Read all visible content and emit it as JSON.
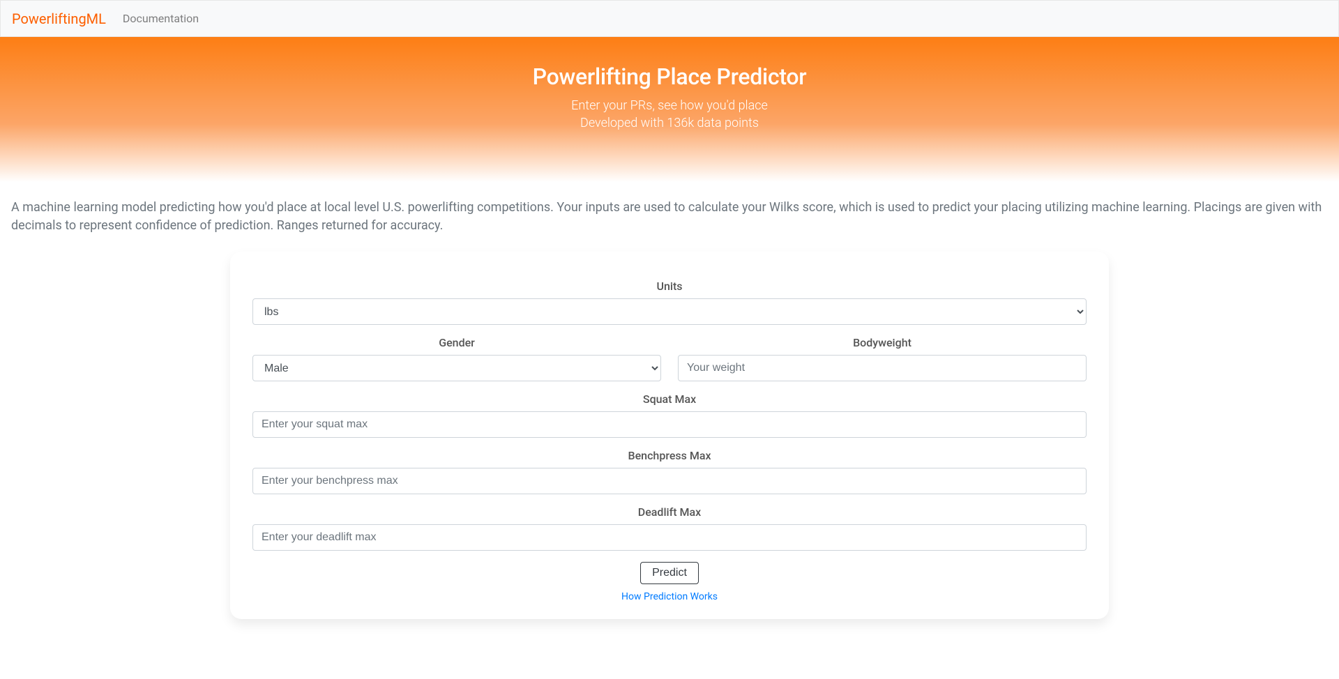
{
  "nav": {
    "brand": "PowerliftingML",
    "doc_link": "Documentation"
  },
  "hero": {
    "title": "Powerlifting Place Predictor",
    "sub1": "Enter your PRs, see how you'd place",
    "sub2": "Developed with 136k data points"
  },
  "description": "A machine learning model predicting how you'd place at local level U.S. powerlifting competitions. Your inputs are used to calculate your Wilks score, which is used to predict your placing utilizing machine learning. Placings are given with decimals to represent confidence of prediction. Ranges returned for accuracy.",
  "form": {
    "units_label": "Units",
    "units_selected": "lbs",
    "gender_label": "Gender",
    "gender_selected": "Male",
    "bodyweight_label": "Bodyweight",
    "bodyweight_placeholder": "Your weight",
    "squat_label": "Squat Max",
    "squat_placeholder": "Enter your squat max",
    "bench_label": "Benchpress Max",
    "bench_placeholder": "Enter your benchpress max",
    "deadlift_label": "Deadlift Max",
    "deadlift_placeholder": "Enter your deadlift max",
    "predict_button": "Predict",
    "how_link": "How Prediction Works"
  }
}
